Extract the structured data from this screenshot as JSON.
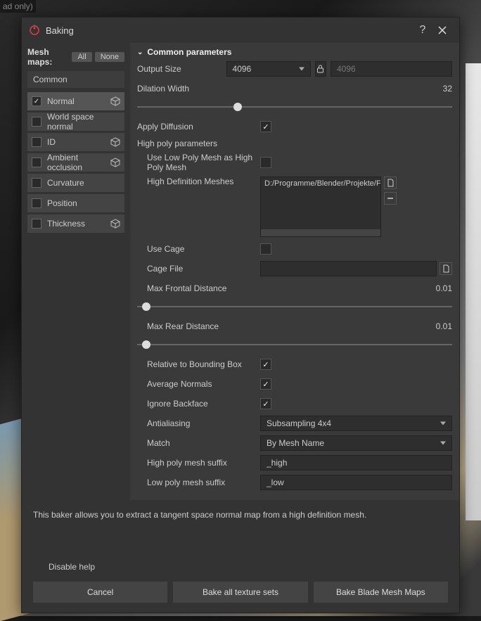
{
  "toptag": "ad only)",
  "dialog": {
    "title": "Baking",
    "help_glyph": "?",
    "close_glyph": "✕"
  },
  "sidebar": {
    "header": "Mesh maps:",
    "chip_all": "All",
    "chip_none": "None",
    "category": "Common",
    "items": [
      {
        "label": "Normal",
        "checked": true,
        "cube": true,
        "active": true
      },
      {
        "label": "World space normal",
        "checked": false,
        "cube": false,
        "active": false
      },
      {
        "label": "ID",
        "checked": false,
        "cube": true,
        "active": false
      },
      {
        "label": "Ambient occlusion",
        "checked": false,
        "cube": true,
        "active": false
      },
      {
        "label": "Curvature",
        "checked": false,
        "cube": false,
        "active": false
      },
      {
        "label": "Position",
        "checked": false,
        "cube": false,
        "active": false
      },
      {
        "label": "Thickness",
        "checked": false,
        "cube": true,
        "active": false
      }
    ]
  },
  "main": {
    "section_title": "Common parameters",
    "output_size": {
      "label": "Output Size",
      "value": "4096",
      "locked_value": "4096"
    },
    "dilation": {
      "label": "Dilation Width",
      "value": "32",
      "pos_pct": 32
    },
    "apply_diffusion": {
      "label": "Apply Diffusion",
      "checked": true
    },
    "high_poly_header": "High poly parameters",
    "use_low_as_high": {
      "label": "Use Low Poly Mesh as High Poly Mesh",
      "checked": false
    },
    "hd_meshes": {
      "label": "High Definition Meshes",
      "path": "D:/Programme/Blender/Projekte/Fer"
    },
    "use_cage": {
      "label": "Use Cage",
      "checked": false
    },
    "cage_file": {
      "label": "Cage File",
      "value": ""
    },
    "max_frontal": {
      "label": "Max Frontal Distance",
      "value": "0.01",
      "pos_pct": 3
    },
    "max_rear": {
      "label": "Max Rear Distance",
      "value": "0.01",
      "pos_pct": 3
    },
    "rel_bbox": {
      "label": "Relative to Bounding Box",
      "checked": true
    },
    "avg_normals": {
      "label": "Average Normals",
      "checked": true
    },
    "ignore_backface": {
      "label": "Ignore Backface",
      "checked": true
    },
    "antialiasing": {
      "label": "Antialiasing",
      "value": "Subsampling 4x4"
    },
    "match": {
      "label": "Match",
      "value": "By Mesh Name"
    },
    "hp_suffix": {
      "label": "High poly mesh suffix",
      "value": "_high"
    },
    "lp_suffix": {
      "label": "Low poly mesh suffix",
      "value": "_low"
    }
  },
  "footer": {
    "help_text": "This baker allows you to extract a tangent space normal map from a high definition mesh.",
    "disable_help": "Disable help",
    "cancel": "Cancel",
    "bake_all": "Bake all texture sets",
    "bake_one": "Bake Blade Mesh Maps"
  }
}
